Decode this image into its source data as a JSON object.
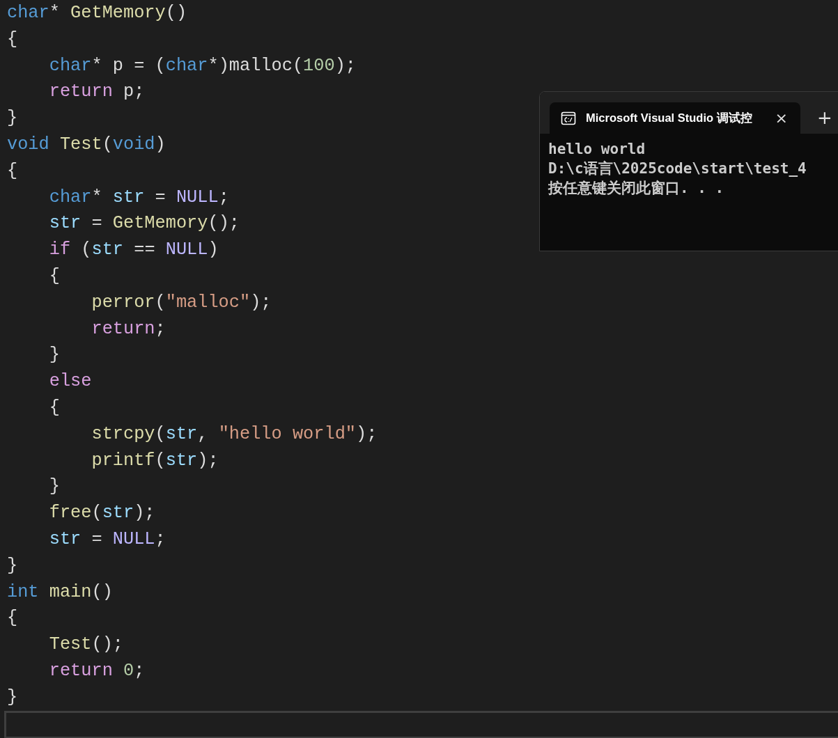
{
  "editor": {
    "lines": [
      {
        "tokens": [
          {
            "text": "char",
            "kind": "keyword"
          },
          {
            "text": "* ",
            "kind": "plain"
          },
          {
            "text": "GetMemory",
            "kind": "function"
          },
          {
            "text": "()",
            "kind": "plain"
          }
        ]
      },
      {
        "tokens": [
          {
            "text": "{",
            "kind": "plain"
          }
        ]
      },
      {
        "tokens": [
          {
            "text": "    char",
            "kind": "keyword"
          },
          {
            "text": "* p = (",
            "kind": "plain"
          },
          {
            "text": "char",
            "kind": "keyword"
          },
          {
            "text": "*)",
            "kind": "plain"
          },
          {
            "text": "malloc",
            "kind": "plain"
          },
          {
            "text": "(",
            "kind": "plain"
          },
          {
            "text": "100",
            "kind": "number"
          },
          {
            "text": ");",
            "kind": "plain"
          }
        ]
      },
      {
        "tokens": [
          {
            "text": "    return",
            "kind": "control"
          },
          {
            "text": " p;",
            "kind": "plain"
          }
        ]
      },
      {
        "tokens": [
          {
            "text": "}",
            "kind": "plain"
          }
        ]
      },
      {
        "tokens": [
          {
            "text": "void ",
            "kind": "keyword"
          },
          {
            "text": "Test",
            "kind": "function"
          },
          {
            "text": "(",
            "kind": "plain"
          },
          {
            "text": "void",
            "kind": "keyword"
          },
          {
            "text": ")",
            "kind": "plain"
          }
        ]
      },
      {
        "tokens": [
          {
            "text": "{",
            "kind": "plain"
          }
        ]
      },
      {
        "tokens": [
          {
            "text": "    char",
            "kind": "keyword"
          },
          {
            "text": "* ",
            "kind": "plain"
          },
          {
            "text": "str",
            "kind": "variable"
          },
          {
            "text": " = ",
            "kind": "plain"
          },
          {
            "text": "NULL",
            "kind": "macro"
          },
          {
            "text": ";",
            "kind": "plain"
          }
        ]
      },
      {
        "tokens": [
          {
            "text": "    str",
            "kind": "variable"
          },
          {
            "text": " = ",
            "kind": "plain"
          },
          {
            "text": "GetMemory",
            "kind": "function"
          },
          {
            "text": "();",
            "kind": "plain"
          }
        ]
      },
      {
        "tokens": [
          {
            "text": "    if",
            "kind": "control"
          },
          {
            "text": " (",
            "kind": "plain"
          },
          {
            "text": "str",
            "kind": "variable"
          },
          {
            "text": " == ",
            "kind": "plain"
          },
          {
            "text": "NULL",
            "kind": "macro"
          },
          {
            "text": ")",
            "kind": "plain"
          }
        ]
      },
      {
        "tokens": [
          {
            "text": "    {",
            "kind": "plain"
          }
        ]
      },
      {
        "tokens": [
          {
            "text": "        perror",
            "kind": "function"
          },
          {
            "text": "(",
            "kind": "plain"
          },
          {
            "text": "\"malloc\"",
            "kind": "string"
          },
          {
            "text": ");",
            "kind": "plain"
          }
        ]
      },
      {
        "tokens": [
          {
            "text": "        return",
            "kind": "control"
          },
          {
            "text": ";",
            "kind": "plain"
          }
        ]
      },
      {
        "tokens": [
          {
            "text": "    }",
            "kind": "plain"
          }
        ]
      },
      {
        "tokens": [
          {
            "text": "    else",
            "kind": "control"
          }
        ]
      },
      {
        "tokens": [
          {
            "text": "    {",
            "kind": "plain"
          }
        ]
      },
      {
        "tokens": [
          {
            "text": "        strcpy",
            "kind": "function"
          },
          {
            "text": "(",
            "kind": "plain"
          },
          {
            "text": "str",
            "kind": "variable"
          },
          {
            "text": ", ",
            "kind": "plain"
          },
          {
            "text": "\"hello world\"",
            "kind": "string"
          },
          {
            "text": ");",
            "kind": "plain"
          }
        ]
      },
      {
        "tokens": [
          {
            "text": "        printf",
            "kind": "function"
          },
          {
            "text": "(",
            "kind": "plain"
          },
          {
            "text": "str",
            "kind": "variable"
          },
          {
            "text": ");",
            "kind": "plain"
          }
        ]
      },
      {
        "tokens": [
          {
            "text": "    }",
            "kind": "plain"
          }
        ]
      },
      {
        "tokens": [
          {
            "text": "    free",
            "kind": "function"
          },
          {
            "text": "(",
            "kind": "plain"
          },
          {
            "text": "str",
            "kind": "variable"
          },
          {
            "text": ");",
            "kind": "plain"
          }
        ]
      },
      {
        "tokens": [
          {
            "text": "    str",
            "kind": "variable"
          },
          {
            "text": " = ",
            "kind": "plain"
          },
          {
            "text": "NULL",
            "kind": "macro"
          },
          {
            "text": ";",
            "kind": "plain"
          }
        ]
      },
      {
        "tokens": [
          {
            "text": "}",
            "kind": "plain"
          }
        ]
      },
      {
        "tokens": [
          {
            "text": "int ",
            "kind": "keyword"
          },
          {
            "text": "main",
            "kind": "function"
          },
          {
            "text": "()",
            "kind": "plain"
          }
        ]
      },
      {
        "tokens": [
          {
            "text": "{",
            "kind": "plain"
          }
        ]
      },
      {
        "tokens": [
          {
            "text": "    Test",
            "kind": "function"
          },
          {
            "text": "();",
            "kind": "plain"
          }
        ]
      },
      {
        "tokens": [
          {
            "text": "    return ",
            "kind": "control"
          },
          {
            "text": "0",
            "kind": "number"
          },
          {
            "text": ";",
            "kind": "plain"
          }
        ]
      },
      {
        "tokens": [
          {
            "text": "}",
            "kind": "plain"
          }
        ]
      }
    ]
  },
  "console": {
    "tab": {
      "title": "Microsoft Visual Studio 调试控",
      "close": "×"
    },
    "new_tab": "+",
    "output": [
      "hello world",
      "D:\\c语言\\2025code\\start\\test_4",
      "按任意键关闭此窗口. . ."
    ]
  }
}
